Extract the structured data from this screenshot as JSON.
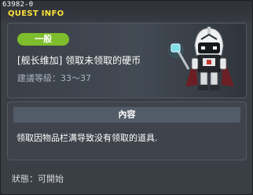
{
  "window": {
    "id": "63982-0",
    "title": "QUEST INFO"
  },
  "quest": {
    "category": "一般",
    "name": "[舰长维加] 领取未领取的硬币",
    "level_range": "建議等級：33～37",
    "npc_icon": "armored-robot-captain-npc"
  },
  "content": {
    "header": "內容",
    "text": "领取因物品栏满导致没有领取的道具."
  },
  "status": {
    "text": "狀態：可開始"
  },
  "colors": {
    "title": "#ffe13a",
    "category_pill": "#7ebd2b",
    "level_text": "#a9b3bf",
    "content_header_bg": "#525c68"
  }
}
